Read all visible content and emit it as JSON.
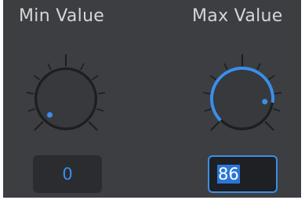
{
  "min_knob": {
    "label": "Min Value",
    "value": "0",
    "fraction": 0.0
  },
  "max_knob": {
    "label": "Max Value",
    "value": "86",
    "fraction": 0.86
  },
  "colors": {
    "panel_bg": "#3c3e42",
    "accent": "#3a8fe8",
    "label_text": "#d6d6d6"
  }
}
